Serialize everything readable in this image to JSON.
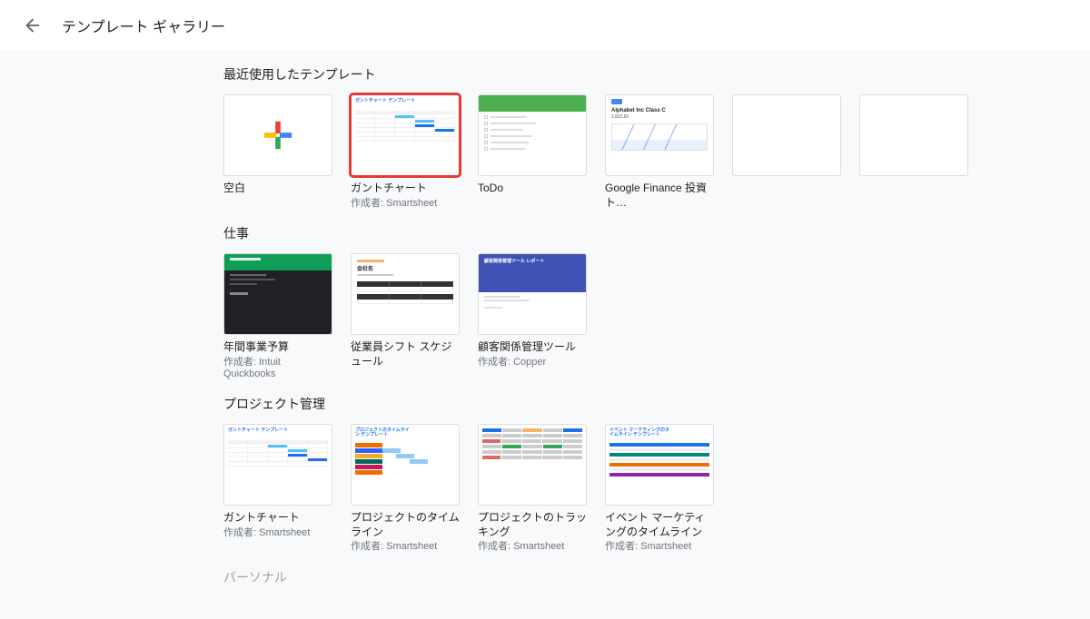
{
  "header": {
    "title": "テンプレート ギャラリー"
  },
  "sections": {
    "recent": {
      "title": "最近使用したテンプレート",
      "items": [
        {
          "title": "空白",
          "sub": ""
        },
        {
          "title": "ガントチャート",
          "sub": "作成者: Smartsheet"
        },
        {
          "title": "ToDo",
          "sub": ""
        },
        {
          "title": "Google Finance 投資ト…",
          "sub": ""
        },
        {
          "title": "",
          "sub": ""
        },
        {
          "title": "",
          "sub": ""
        }
      ]
    },
    "work": {
      "title": "仕事",
      "items": [
        {
          "title": "年間事業予算",
          "sub": "作成者: Intuit Quickbooks"
        },
        {
          "title": "従業員シフト スケジュール",
          "sub": ""
        },
        {
          "title": "顧客関係管理ツール",
          "sub": "作成者: Copper"
        }
      ]
    },
    "project": {
      "title": "プロジェクト管理",
      "items": [
        {
          "title": "ガントチャート",
          "sub": "作成者: Smartsheet"
        },
        {
          "title": "プロジェクトのタイムライン",
          "sub": "作成者: Smartsheet"
        },
        {
          "title": "プロジェクトのトラッキング",
          "sub": "作成者: Smartsheet"
        },
        {
          "title": "イベント マーケティングのタイムライン",
          "sub": "作成者: Smartsheet"
        }
      ]
    },
    "next": {
      "title": "パーソナル"
    }
  },
  "colors": {
    "google_blue": "#4285f4",
    "google_red": "#ea4335",
    "google_yellow": "#fbbc05",
    "google_green": "#34a853",
    "highlight": "#e53935"
  },
  "thumb_labels": {
    "gantt_header": "ガントチャート テンプレート",
    "company": "会社名",
    "crm_header": "顧客関係管理ツール レポート",
    "finance_name": "Alphabet Inc Class C",
    "finance_price": "2,823.81",
    "timeline_header": "プロジェクトのタイムライン テンプレート",
    "event_header": "イベント マーケティングのタイムライン テンプレート"
  }
}
